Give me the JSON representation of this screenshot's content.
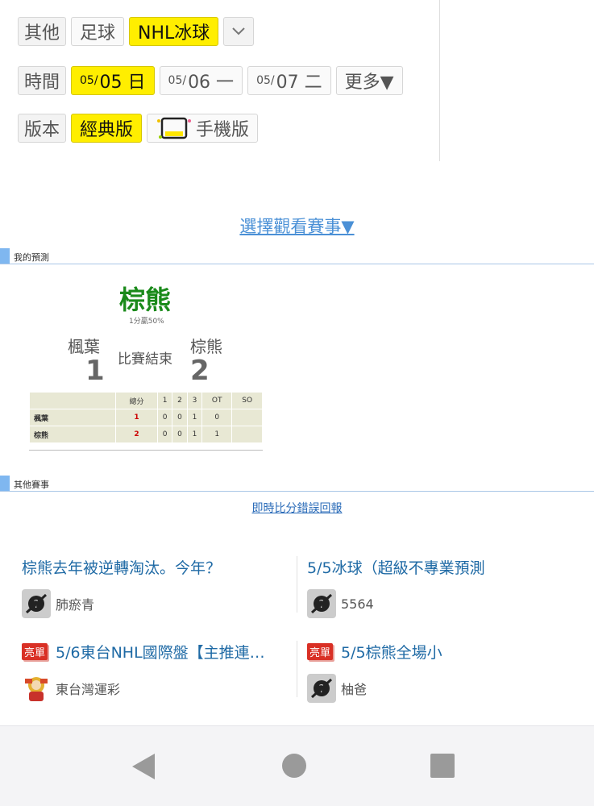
{
  "filters": {
    "row1": {
      "label": "其他",
      "options": [
        "足球",
        "NHL冰球"
      ],
      "selected": "NHL冰球",
      "dropdown_icon": "chevron-down-icon"
    },
    "row2": {
      "label": "時間",
      "dates": [
        {
          "prefix": "05/",
          "main": "05 日",
          "selected": true
        },
        {
          "prefix": "05/",
          "main": "06 一",
          "selected": false
        },
        {
          "prefix": "05/",
          "main": "07 二",
          "selected": false
        }
      ],
      "more": "更多▼"
    },
    "row3": {
      "label": "版本",
      "options": [
        "經典版",
        "手機版"
      ],
      "selected": "經典版"
    }
  },
  "choose_link": "選擇觀看賽事▼",
  "my_prediction": {
    "section_title": "我的預測",
    "winner": "棕熊",
    "odds_text": "1分贏50%",
    "status": "比賽結束",
    "team1": {
      "name": "楓葉",
      "score": "1"
    },
    "team2": {
      "name": "棕熊",
      "score": "2"
    },
    "table": {
      "headers": [
        "",
        "總分",
        "1",
        "2",
        "3",
        "OT",
        "SO"
      ],
      "rows": [
        [
          "楓葉",
          "1",
          "0",
          "0",
          "1",
          "0",
          ""
        ],
        [
          "棕熊",
          "2",
          "0",
          "0",
          "1",
          "1",
          ""
        ]
      ]
    }
  },
  "other_games": {
    "section_title": "其他賽事",
    "report_link": "即時比分錯誤回報"
  },
  "articles": [
    {
      "badge": "",
      "title": "棕熊去年被逆轉淘汰。今年？",
      "author": "肺瘀青"
    },
    {
      "badge": "",
      "title": "5/5冰球（超級不專業預測",
      "author": "5564"
    },
    {
      "badge": "亮單",
      "title": "5/6東台NHL國際盤【主推連…",
      "author": "東台灣運彩"
    },
    {
      "badge": "亮單",
      "title": "5/5棕熊全場小",
      "author": "柚爸"
    }
  ],
  "colors": {
    "selected": "#ffee00",
    "winner": "#1a8a1a",
    "link": "#1f6aa5",
    "badge": "#d93025"
  }
}
